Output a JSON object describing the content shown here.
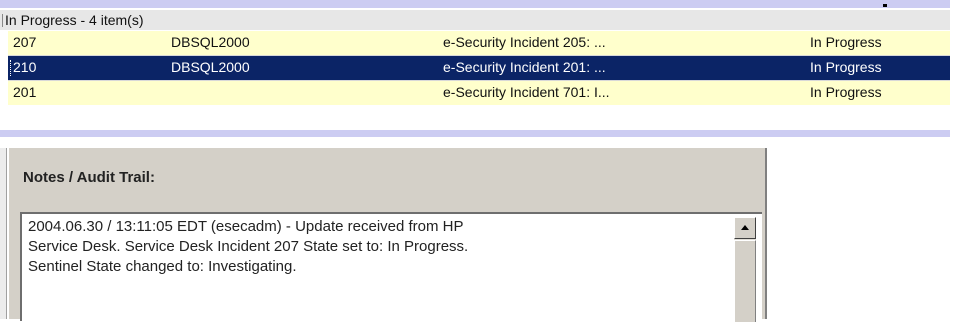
{
  "incidents": {
    "group_header": "In Progress - 4 item(s)",
    "rows": [
      {
        "id": "207",
        "server": "DBSQL2000",
        "title": "e-Security Incident 205: ...",
        "status": "In Progress"
      },
      {
        "id": "210",
        "server": "DBSQL2000",
        "title": "e-Security Incident 201: ...",
        "status": "In Progress"
      },
      {
        "id": "201",
        "server": "",
        "title": "e-Security Incident 701: I...",
        "status": "In Progress"
      }
    ]
  },
  "notes": {
    "title": "Notes / Audit Trail:",
    "lines": [
      "2004.06.30 / 13:11:05 EDT (esecadm) - Update received from HP",
      "Service Desk.  Service Desk Incident 207 State set to: In Progress.",
      "Sentinel State changed to: Investigating."
    ]
  },
  "colors": {
    "row_background": "#ffffcc",
    "selected_row_background": "#0b2466",
    "frame_band": "#ccccf2",
    "panel_background": "#d4d0c8"
  }
}
